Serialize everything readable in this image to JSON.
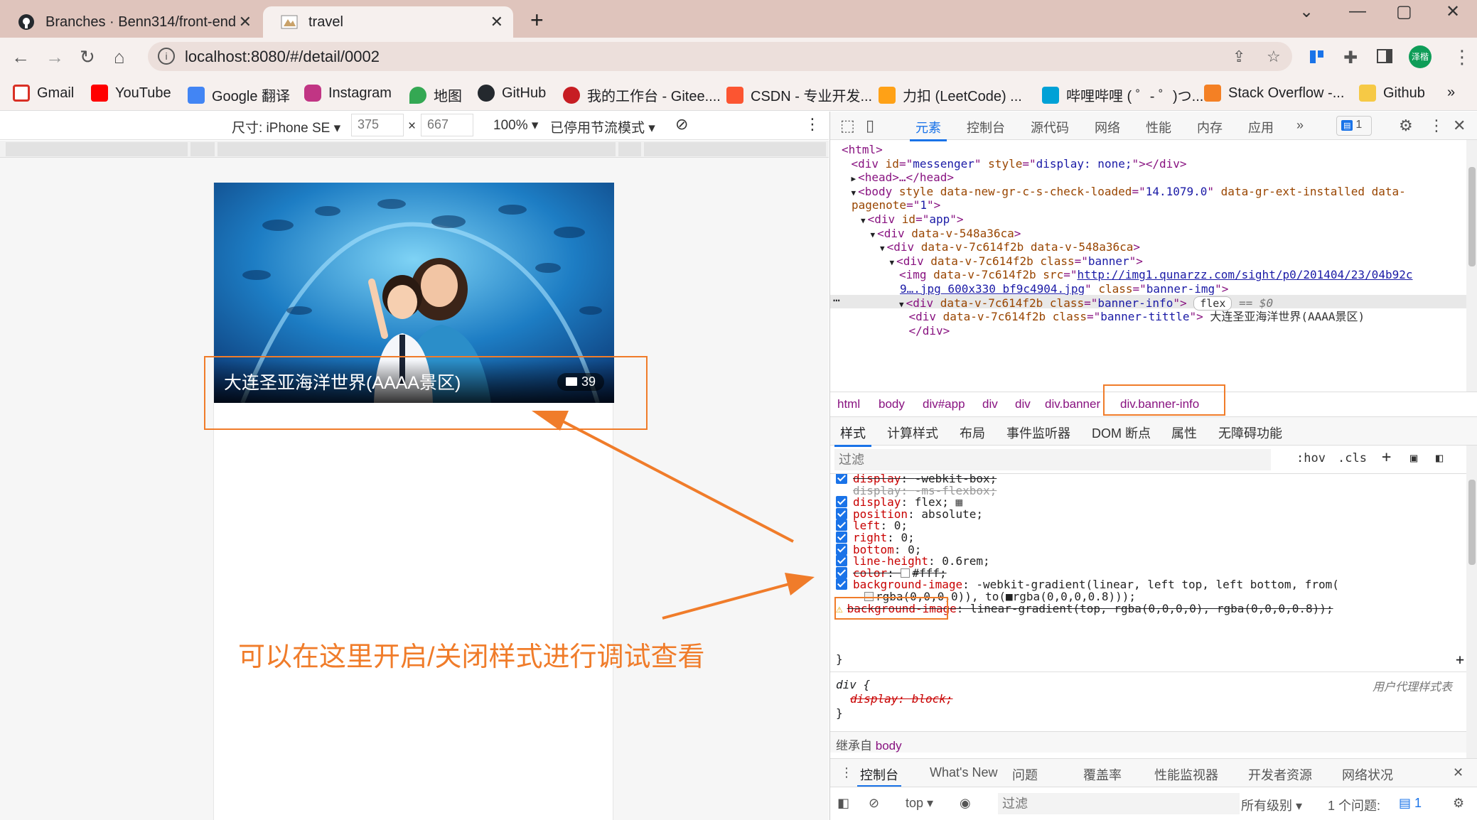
{
  "browser": {
    "tabs": [
      {
        "title": "Branches · Benn314/front-end"
      },
      {
        "title": "travel"
      }
    ],
    "url": "localhost:8080/#/detail/0002",
    "profile_initials": "泽楷"
  },
  "bookmarks": [
    {
      "label": "Gmail",
      "color": "#d93025"
    },
    {
      "label": "YouTube",
      "color": "#ff0000"
    },
    {
      "label": "Google 翻译",
      "color": "#4285f4"
    },
    {
      "label": "Instagram",
      "color": "#c13584"
    },
    {
      "label": "地图",
      "color": "#34a853"
    },
    {
      "label": "GitHub",
      "color": "#24292e"
    },
    {
      "label": "我的工作台 - Gitee....",
      "color": "#c71d23"
    },
    {
      "label": "CSDN - 专业开发...",
      "color": "#fc5531"
    },
    {
      "label": "力扣 (LeetCode) ...",
      "color": "#ffa116"
    },
    {
      "label": "哔哩哔哩 ( ゜- ゜)つ...",
      "color": "#00a1d6"
    },
    {
      "label": "Stack Overflow -...",
      "color": "#f48024"
    },
    {
      "label": "Github",
      "color": "#f6c945"
    }
  ],
  "device_toolbar": {
    "size_label": "尺寸: iPhone SE ▾",
    "width": "375",
    "height": "667",
    "times": "×",
    "zoom": "100% ▾",
    "throttle": "已停用节流模式 ▾"
  },
  "page": {
    "banner_title": "大连圣亚海洋世界(AAAA景区)",
    "image_count": "39"
  },
  "annotation": "可以在这里开启/关闭样式进行调试查看",
  "devtools": {
    "tabs": [
      "元素",
      "控制台",
      "源代码",
      "网络",
      "性能",
      "内存",
      "应用"
    ],
    "more": "»",
    "issues_count": "1",
    "dom_lines": [
      {
        "indent": 0,
        "arrow": "",
        "parts": [
          [
            "tag",
            "<html>"
          ]
        ]
      },
      {
        "indent": 1,
        "arrow": "",
        "parts": [
          [
            "tag",
            "<div "
          ],
          [
            "an",
            "id"
          ],
          [
            "tag",
            "=\""
          ],
          [
            "av",
            "messenger"
          ],
          [
            "tag",
            "\" "
          ],
          [
            "an",
            "style"
          ],
          [
            "tag",
            "=\""
          ],
          [
            "av",
            "display: none;"
          ],
          [
            "tag",
            "\"></div>"
          ]
        ]
      },
      {
        "indent": 1,
        "arrow": "▶",
        "parts": [
          [
            "tag",
            "<head>…</head>"
          ]
        ]
      },
      {
        "indent": 1,
        "arrow": "▼",
        "parts": [
          [
            "tag",
            "<body "
          ],
          [
            "an",
            "style data-new-gr-c-s-check-loaded"
          ],
          [
            "tag",
            "=\""
          ],
          [
            "av",
            "14.1079.0"
          ],
          [
            "tag",
            "\" "
          ],
          [
            "an",
            "data-gr-ext-installed data-"
          ]
        ]
      },
      {
        "indent": 1,
        "arrow": "",
        "parts": [
          [
            "an",
            "pagenote"
          ],
          [
            "tag",
            "=\""
          ],
          [
            "av",
            "1"
          ],
          [
            "tag",
            "\">"
          ]
        ]
      },
      {
        "indent": 2,
        "arrow": "▼",
        "parts": [
          [
            "tag",
            "<div "
          ],
          [
            "an",
            "id"
          ],
          [
            "tag",
            "=\""
          ],
          [
            "av",
            "app"
          ],
          [
            "tag",
            "\">"
          ]
        ]
      },
      {
        "indent": 3,
        "arrow": "▼",
        "parts": [
          [
            "tag",
            "<div "
          ],
          [
            "an",
            "data-v-548a36ca"
          ],
          [
            "tag",
            ">"
          ]
        ]
      },
      {
        "indent": 4,
        "arrow": "▼",
        "parts": [
          [
            "tag",
            "<div "
          ],
          [
            "an",
            "data-v-7c614f2b data-v-548a36ca"
          ],
          [
            "tag",
            ">"
          ]
        ]
      },
      {
        "indent": 5,
        "arrow": "▼",
        "parts": [
          [
            "tag",
            "<div "
          ],
          [
            "an",
            "data-v-7c614f2b class"
          ],
          [
            "tag",
            "=\""
          ],
          [
            "av",
            "banner"
          ],
          [
            "tag",
            "\">"
          ]
        ]
      },
      {
        "indent": 6,
        "arrow": "",
        "parts": [
          [
            "tag",
            "<img "
          ],
          [
            "an",
            "data-v-7c614f2b src"
          ],
          [
            "tag",
            "=\""
          ],
          [
            "lnk",
            "http://img1.qunarzz.com/sight/p0/201404/23/04b92c"
          ]
        ]
      },
      {
        "indent": 6,
        "arrow": "",
        "parts": [
          [
            "lnk",
            "9….jpg_600x330_bf9c4904.jpg"
          ],
          [
            "tag",
            "\" "
          ],
          [
            "an",
            "class"
          ],
          [
            "tag",
            "=\""
          ],
          [
            "av",
            "banner-img"
          ],
          [
            "tag",
            "\">"
          ]
        ]
      },
      {
        "indent": 6,
        "arrow": "▼",
        "parts": [
          [
            "tag",
            "<div "
          ],
          [
            "an",
            "data-v-7c614f2b class"
          ],
          [
            "tag",
            "=\""
          ],
          [
            "av",
            "banner-info"
          ],
          [
            "tag",
            "\">"
          ]
        ]
      },
      {
        "indent": 7,
        "arrow": "",
        "parts": [
          [
            "tag",
            "<div "
          ],
          [
            "an",
            "data-v-7c614f2b class"
          ],
          [
            "tag",
            "=\""
          ],
          [
            "av",
            "banner-tittle"
          ],
          [
            "tag",
            "\"> "
          ],
          [
            "txt",
            "大连圣亚海洋世界(AAAA景区)"
          ]
        ]
      },
      {
        "indent": 7,
        "arrow": "",
        "parts": [
          [
            "tag",
            "</div>"
          ]
        ]
      }
    ],
    "selected_flex_badge": "flex",
    "selected_eq": "== $0",
    "breadcrumbs": [
      "html",
      "body",
      "div#app",
      "div",
      "div",
      "div.banner",
      "div.banner-info"
    ],
    "style_tabs": [
      "样式",
      "计算样式",
      "布局",
      "事件监听器",
      "DOM 断点",
      "属性",
      "无障碍功能"
    ],
    "filter_placeholder": "过滤",
    "hov": ":hov",
    "cls": ".cls",
    "rules": [
      {
        "check": true,
        "strike": true,
        "name": "display",
        "value": "-webkit-box;"
      },
      {
        "check": false,
        "strike": true,
        "grey": true,
        "name": "display",
        "value": "-ms-flexbox;"
      },
      {
        "check": true,
        "name": "display",
        "value": "flex;"
      },
      {
        "check": true,
        "name": "position",
        "value": "absolute;"
      },
      {
        "check": true,
        "name": "left",
        "value": "0;"
      },
      {
        "check": true,
        "name": "right",
        "value": "0;"
      },
      {
        "check": true,
        "name": "bottom",
        "value": "0;"
      },
      {
        "check": true,
        "name": "line-height",
        "value": "0.6rem;"
      },
      {
        "check": true,
        "strike": true,
        "name": "color",
        "value": "#fff;"
      },
      {
        "check": true,
        "name": "background-image",
        "value": "-webkit-gradient(linear, left top, left bottom, from("
      },
      {
        "cont": "rgba(0,0,0,0)), to(■rgba(0,0,0,0.8)));"
      },
      {
        "warn": true,
        "strike": true,
        "name": "background-image",
        "value": "linear-gradient(top, rgba(0,0,0,0), rgba(0,0,0,0.8));"
      }
    ],
    "close_brace": "}",
    "ua_selector": "div {",
    "ua_label": "用户代理样式表",
    "ua_rule": "display: block;",
    "inherited_label": "继承自",
    "inherited_from": "body",
    "drawer_tabs": [
      "控制台",
      "What's New",
      "问题",
      "覆盖率",
      "性能监视器",
      "开发者资源",
      "网络状况"
    ],
    "console_context": "top ▾",
    "console_filter": "过滤",
    "console_levels": "所有级别 ▾",
    "console_issues": "1 个问题:",
    "console_issue_count": "1"
  }
}
